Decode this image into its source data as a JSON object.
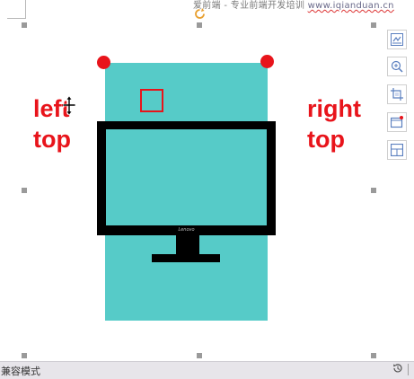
{
  "header": {
    "text": "爱前端 - 专业前端开发培训 ",
    "link": "www.iqianduan.cn"
  },
  "labels": {
    "left_top_line1": "left",
    "left_top_line2": "top",
    "right_top_line1": "right",
    "right_top_line2": "top"
  },
  "monitor": {
    "brand": "Lenovo"
  },
  "colors": {
    "canvas": "#56cbc8",
    "accent_red": "#e8141b",
    "status_bar": "#e7e5ea"
  },
  "toolbar": {
    "icons": [
      "layout-options-icon",
      "zoom-icon",
      "crop-icon",
      "picture-frame-icon",
      "split-layout-icon"
    ]
  },
  "status_bar": {
    "mode": "兼容模式"
  }
}
